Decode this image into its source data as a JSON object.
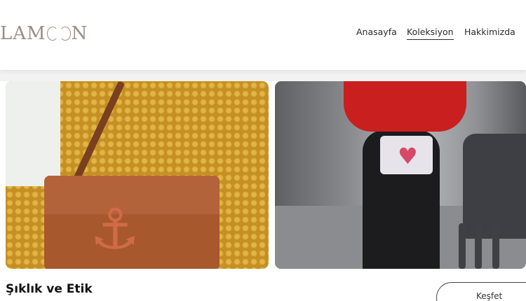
{
  "header": {
    "logo_text": "LAMOON",
    "nav": [
      {
        "label": "Anasayfa",
        "active": false
      },
      {
        "label": "Koleksiyon",
        "active": true
      },
      {
        "label": "Hakkimizda",
        "active": false
      }
    ]
  },
  "gallery": {
    "images": [
      {
        "description_icon": "photo-sweater-bag"
      },
      {
        "description_icon": "photo-street-fashion"
      }
    ]
  },
  "section": {
    "title": "Şıklık ve Etik",
    "cta_label": "Keşfet"
  },
  "colors": {
    "logo": "#9a8f86",
    "text": "#2b2b2b",
    "background": "#ffffff"
  }
}
